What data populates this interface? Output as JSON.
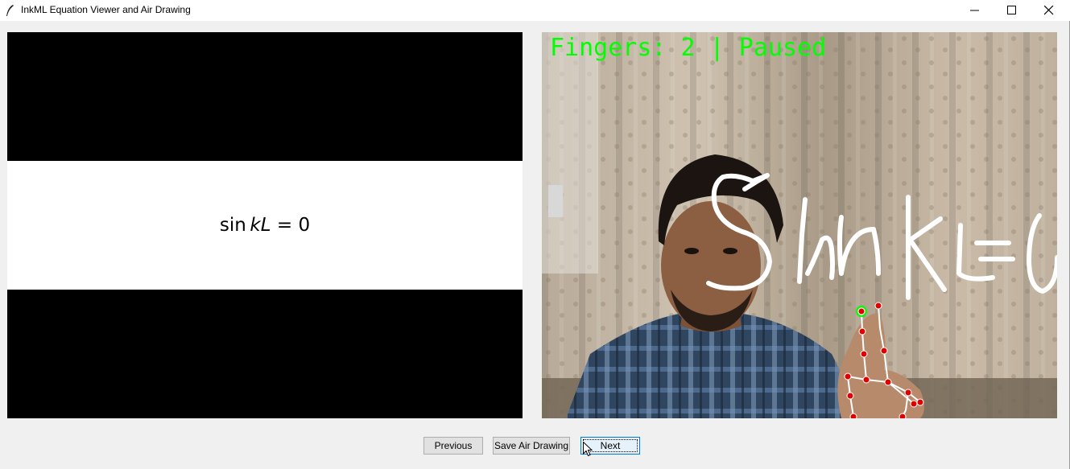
{
  "window": {
    "title": "InkML Equation Viewer and Air Drawing",
    "controls": [
      "minimize-icon",
      "maximize-icon",
      "close-icon"
    ]
  },
  "equation_panel": {
    "func": "sin",
    "var1": "k",
    "var2": "L",
    "rhs": "= 0"
  },
  "camera_panel": {
    "status_text": "Fingers: 2 | Paused",
    "status_color": "#00ff00",
    "drawing_color": "#ffffff",
    "landmark_color": "#e00000"
  },
  "buttons": {
    "previous": "Previous",
    "save": "Save Air Drawing",
    "next": "Next"
  }
}
